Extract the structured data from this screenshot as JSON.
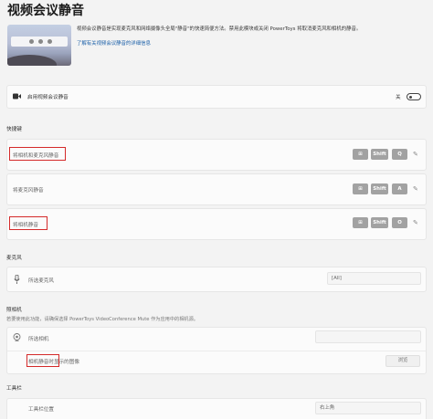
{
  "page": {
    "title": "视频会议静音",
    "description": "视频会议静音是实现麦克风和网络摄像头全局\"静音\"的快速简便方法。禁用此模块或关闭 PowerToys 将取消麦克风和相机的静音。",
    "learn_more": "了解有关视频会议静音的详细信息"
  },
  "enable": {
    "label": "启用视频会议静音",
    "state_text": "关"
  },
  "shortcuts": {
    "section_title": "快捷键",
    "items": [
      {
        "label": "将相机和麦克风静音",
        "keys": [
          "⊞",
          "Shift",
          "Q"
        ]
      },
      {
        "label": "将麦克风静音",
        "keys": [
          "⊞",
          "Shift",
          "A"
        ]
      },
      {
        "label": "将相机静音",
        "keys": [
          "⊞",
          "Shift",
          "O"
        ]
      }
    ]
  },
  "microphone": {
    "section_title": "麦克风",
    "label": "所选麦克风",
    "value": "[All]"
  },
  "camera": {
    "section_title": "照相机",
    "note": "若要使用此功能，请确保选择 PowerToys VideoConference Mute 作为应用中的相机源。",
    "label": "所选相机",
    "overlay_label": "相机静音时显示的图像",
    "browse": "浏览"
  },
  "toolbar": {
    "section_title": "工具栏",
    "position_label": "工具栏位置",
    "position_value": "右上角"
  },
  "colors": {
    "highlight": "#d42a2a",
    "key_bg": "#a2a2a2"
  }
}
